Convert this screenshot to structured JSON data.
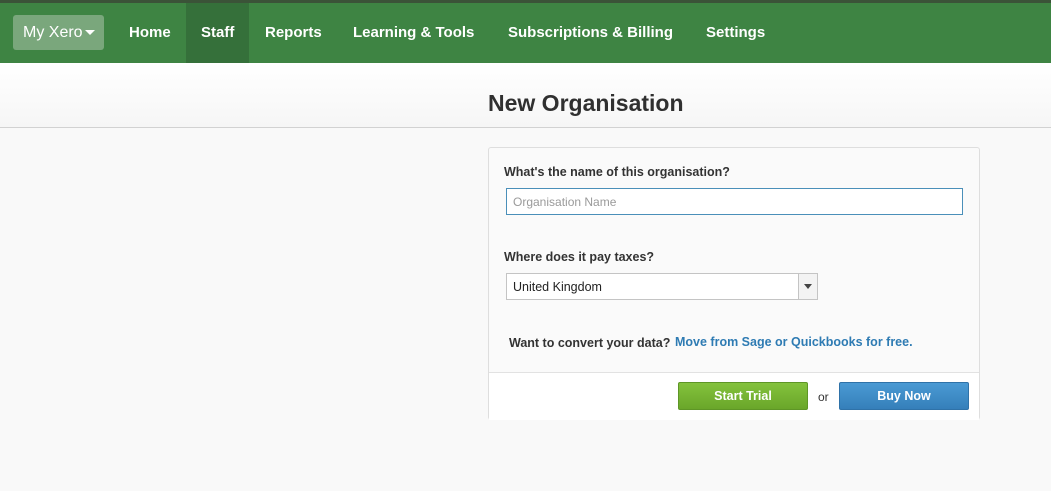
{
  "nav": {
    "my_xero_label": "My Xero",
    "items": [
      {
        "label": "Home",
        "active": false
      },
      {
        "label": "Staff",
        "active": true
      },
      {
        "label": "Reports",
        "active": false
      },
      {
        "label": "Learning & Tools",
        "active": false
      },
      {
        "label": "Subscriptions & Billing",
        "active": false
      },
      {
        "label": "Settings",
        "active": false
      }
    ]
  },
  "page": {
    "title": "New Organisation"
  },
  "form": {
    "name_question": "What's the name of this organisation?",
    "name_placeholder": "Organisation Name",
    "name_value": "",
    "tax_question": "Where does it pay taxes?",
    "tax_selected": "United Kingdom",
    "convert_question": "Want to convert your data?",
    "convert_link": "Move from Sage or Quickbooks for free.",
    "start_trial_label": "Start Trial",
    "or_text": "or",
    "buy_now_label": "Buy Now"
  },
  "colors": {
    "nav_bg": "#3e8443",
    "nav_active": "#35703a",
    "link": "#2e7bb3",
    "trial_button": "#7ab435",
    "buy_button": "#3f8dc8"
  }
}
